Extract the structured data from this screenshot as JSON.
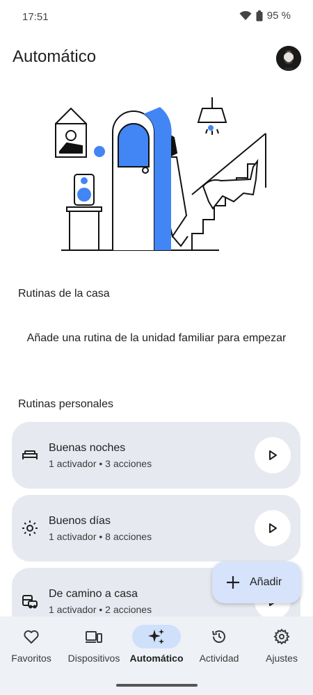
{
  "status": {
    "time": "17:51",
    "battery": "95 %"
  },
  "header": {
    "title": "Automático"
  },
  "home_routines": {
    "title": "Rutinas de la casa",
    "empty_message": "Añade una rutina de la unidad familiar para empezar"
  },
  "personal_routines": {
    "title": "Rutinas personales",
    "items": [
      {
        "name": "Buenas noches",
        "meta": "1 activador • 3 acciones",
        "icon": "bed-icon"
      },
      {
        "name": "Buenos días",
        "meta": "1 activador • 8 acciones",
        "icon": "sun-icon"
      },
      {
        "name": "De camino a casa",
        "meta": "1 activador • 2 acciones",
        "icon": "commute-icon"
      }
    ]
  },
  "fab": {
    "label": "Añadir"
  },
  "nav": {
    "items": [
      {
        "label": "Favoritos",
        "icon": "heart-icon"
      },
      {
        "label": "Dispositivos",
        "icon": "devices-icon"
      },
      {
        "label": "Automático",
        "icon": "sparkle-icon"
      },
      {
        "label": "Actividad",
        "icon": "history-icon"
      },
      {
        "label": "Ajustes",
        "icon": "gear-icon"
      }
    ],
    "active": "Automático"
  },
  "colors": {
    "accent": "#4285f4",
    "card": "#e6eaf0",
    "fab": "#d7e3fb",
    "nav_bg": "#eef1f6",
    "active_pill": "#cfe0fb"
  }
}
